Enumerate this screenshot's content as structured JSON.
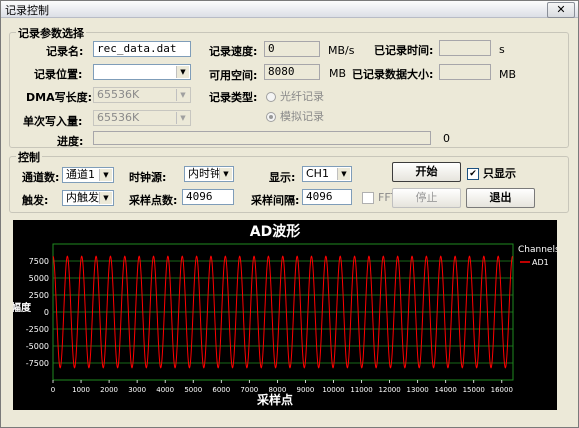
{
  "window": {
    "title": "记录控制",
    "close_label": "✕"
  },
  "record_params": {
    "group_title": "记录参数选择",
    "filename_label": "记录名:",
    "filename_value": "rec_data.dat",
    "speed_label": "记录速度:",
    "speed_value": "0",
    "speed_unit": "MB/s",
    "recorded_time_label": "已记录时间:",
    "recorded_time_value": "",
    "recorded_time_unit": "s",
    "location_label": "记录位置:",
    "location_value": "",
    "free_space_label": "可用空间:",
    "free_space_value": "8080",
    "free_space_unit": "MB",
    "recorded_size_label": "已记录数据大小:",
    "recorded_size_value": "",
    "recorded_size_unit": "MB",
    "dma_label": "DMA写长度:",
    "dma_value": "65536K",
    "record_type_label": "记录类型:",
    "radio_fiber": "光纤记录",
    "radio_analog": "模拟记录",
    "single_write_label": "单次写入量:",
    "single_write_value": "65536K",
    "progress_label": "进度:",
    "progress_value": "0"
  },
  "control": {
    "group_title": "控制",
    "channel_count_label": "通道数:",
    "channel_count_value": "通道1",
    "clock_label": "时钟源:",
    "clock_value": "内时钟",
    "display_label": "显示:",
    "display_value": "CH1",
    "start_button": "开始",
    "only_display_label": "只显示",
    "trigger_label": "触发:",
    "trigger_value": "内触发",
    "sample_points_label": "采样点数:",
    "sample_points_value": "4096",
    "sample_interval_label": "采样间隔:",
    "sample_interval_value": "4096",
    "fft_label": "FFT",
    "stop_button": "停止",
    "exit_button": "退出"
  },
  "colors": {
    "plot_bg": "#000000",
    "grid": "#1f8a1f",
    "trace": "#ff0000",
    "text": "#ffffff"
  },
  "chart_data": {
    "type": "line",
    "title": "AD波形",
    "xlabel": "采样点",
    "ylabel": "幅度",
    "xlim": [
      0,
      16400
    ],
    "ylim": [
      -10000,
      10000
    ],
    "xticks": [
      0,
      1000,
      2000,
      3000,
      4000,
      5000,
      6000,
      7000,
      8000,
      9000,
      10000,
      11000,
      12000,
      13000,
      14000,
      15000,
      16000
    ],
    "yticks": [
      -7500,
      -5000,
      -2500,
      0,
      2500,
      5000,
      7500
    ],
    "legend_title": "Channels",
    "legend_position": "top-right",
    "grid": true,
    "series": [
      {
        "name": "AD1",
        "waveform": "sine",
        "amplitude": 8200,
        "offset": 0,
        "period": 512,
        "x_start": 0,
        "x_end": 16384
      }
    ]
  }
}
